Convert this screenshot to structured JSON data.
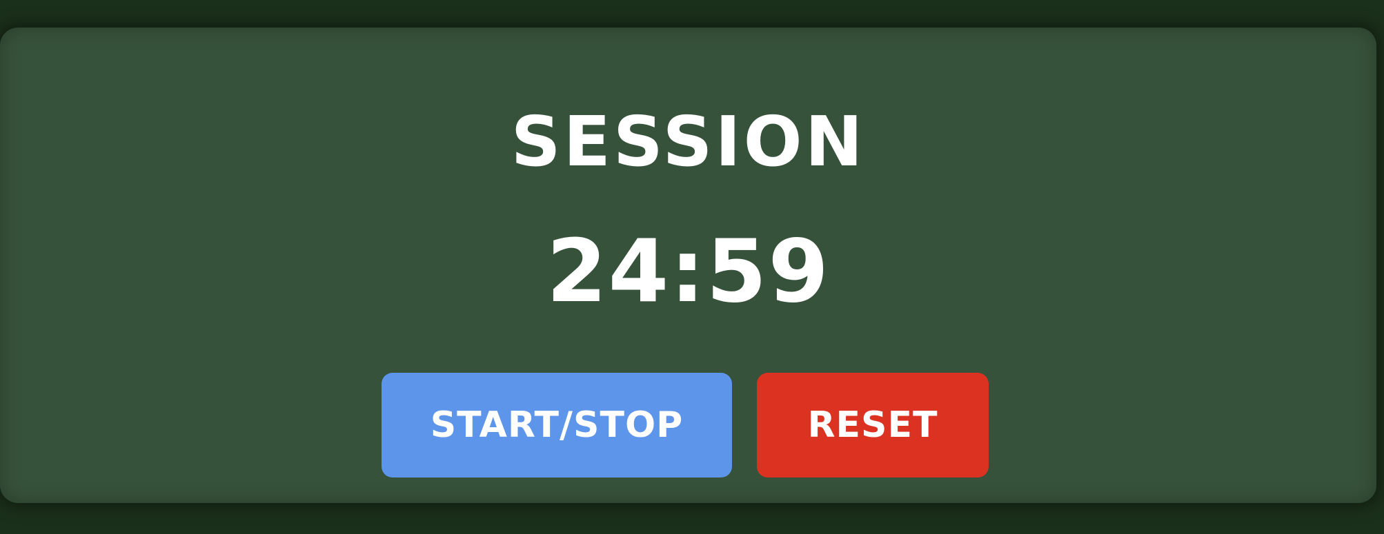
{
  "timer": {
    "label": "SESSION",
    "time": "24:59"
  },
  "controls": {
    "start_stop_label": "START/STOP",
    "reset_label": "RESET"
  },
  "colors": {
    "background": "#1b301b",
    "panel": "#37523a",
    "start_stop": "#5d95ea",
    "reset": "#dc3222",
    "text": "#ffffff"
  }
}
